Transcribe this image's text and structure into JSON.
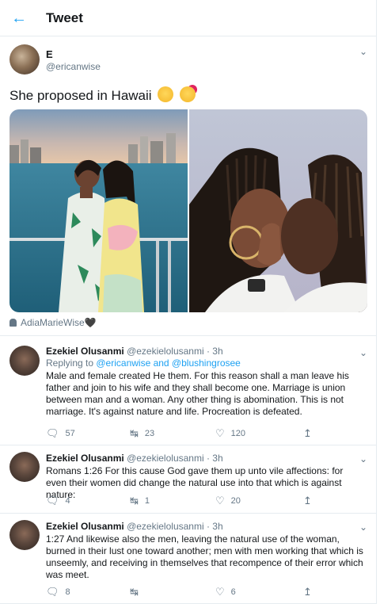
{
  "header": {
    "title": "Tweet"
  },
  "tweet": {
    "name": "E",
    "handle": "@ericanwise",
    "text": "She proposed in Hawaii",
    "tagged": "AdiaMarieWise🖤"
  },
  "replies": [
    {
      "name": "Ezekiel Olusanmi",
      "handle": "@ezekielolusanmi",
      "time": "· 3h",
      "replying_prefix": "Replying to ",
      "replying_to": "@ericanwise and @blushingrosee",
      "text": "Male and female created He them. For this reason shall a man leave his father and join to his wife and they shall become one. Marriage is union between man and a woman.  Any other thing is abomination. This is not marriage.  It's against nature and life. Procreation is defeated.",
      "replies_count": "57",
      "retweets": "23",
      "likes": "120"
    },
    {
      "name": "Ezekiel Olusanmi",
      "handle": "@ezekielolusanmi",
      "time": "· 3h",
      "text": "Romans  1:26 For this cause God gave them up unto vile affections: for even their women did change the natural use into that which is against nature:",
      "replies_count": "4",
      "retweets": "1",
      "likes": "20"
    },
    {
      "name": "Ezekiel Olusanmi",
      "handle": "@ezekielolusanmi",
      "time": "· 3h",
      "text": "1:27 And likewise also the men, leaving the natural use of the woman, burned in their lust one toward another; men with men working that which is unseemly, and receiving in themselves that recompence of their error which was meet.",
      "replies_count": "8",
      "retweets": "",
      "likes": "6"
    }
  ]
}
